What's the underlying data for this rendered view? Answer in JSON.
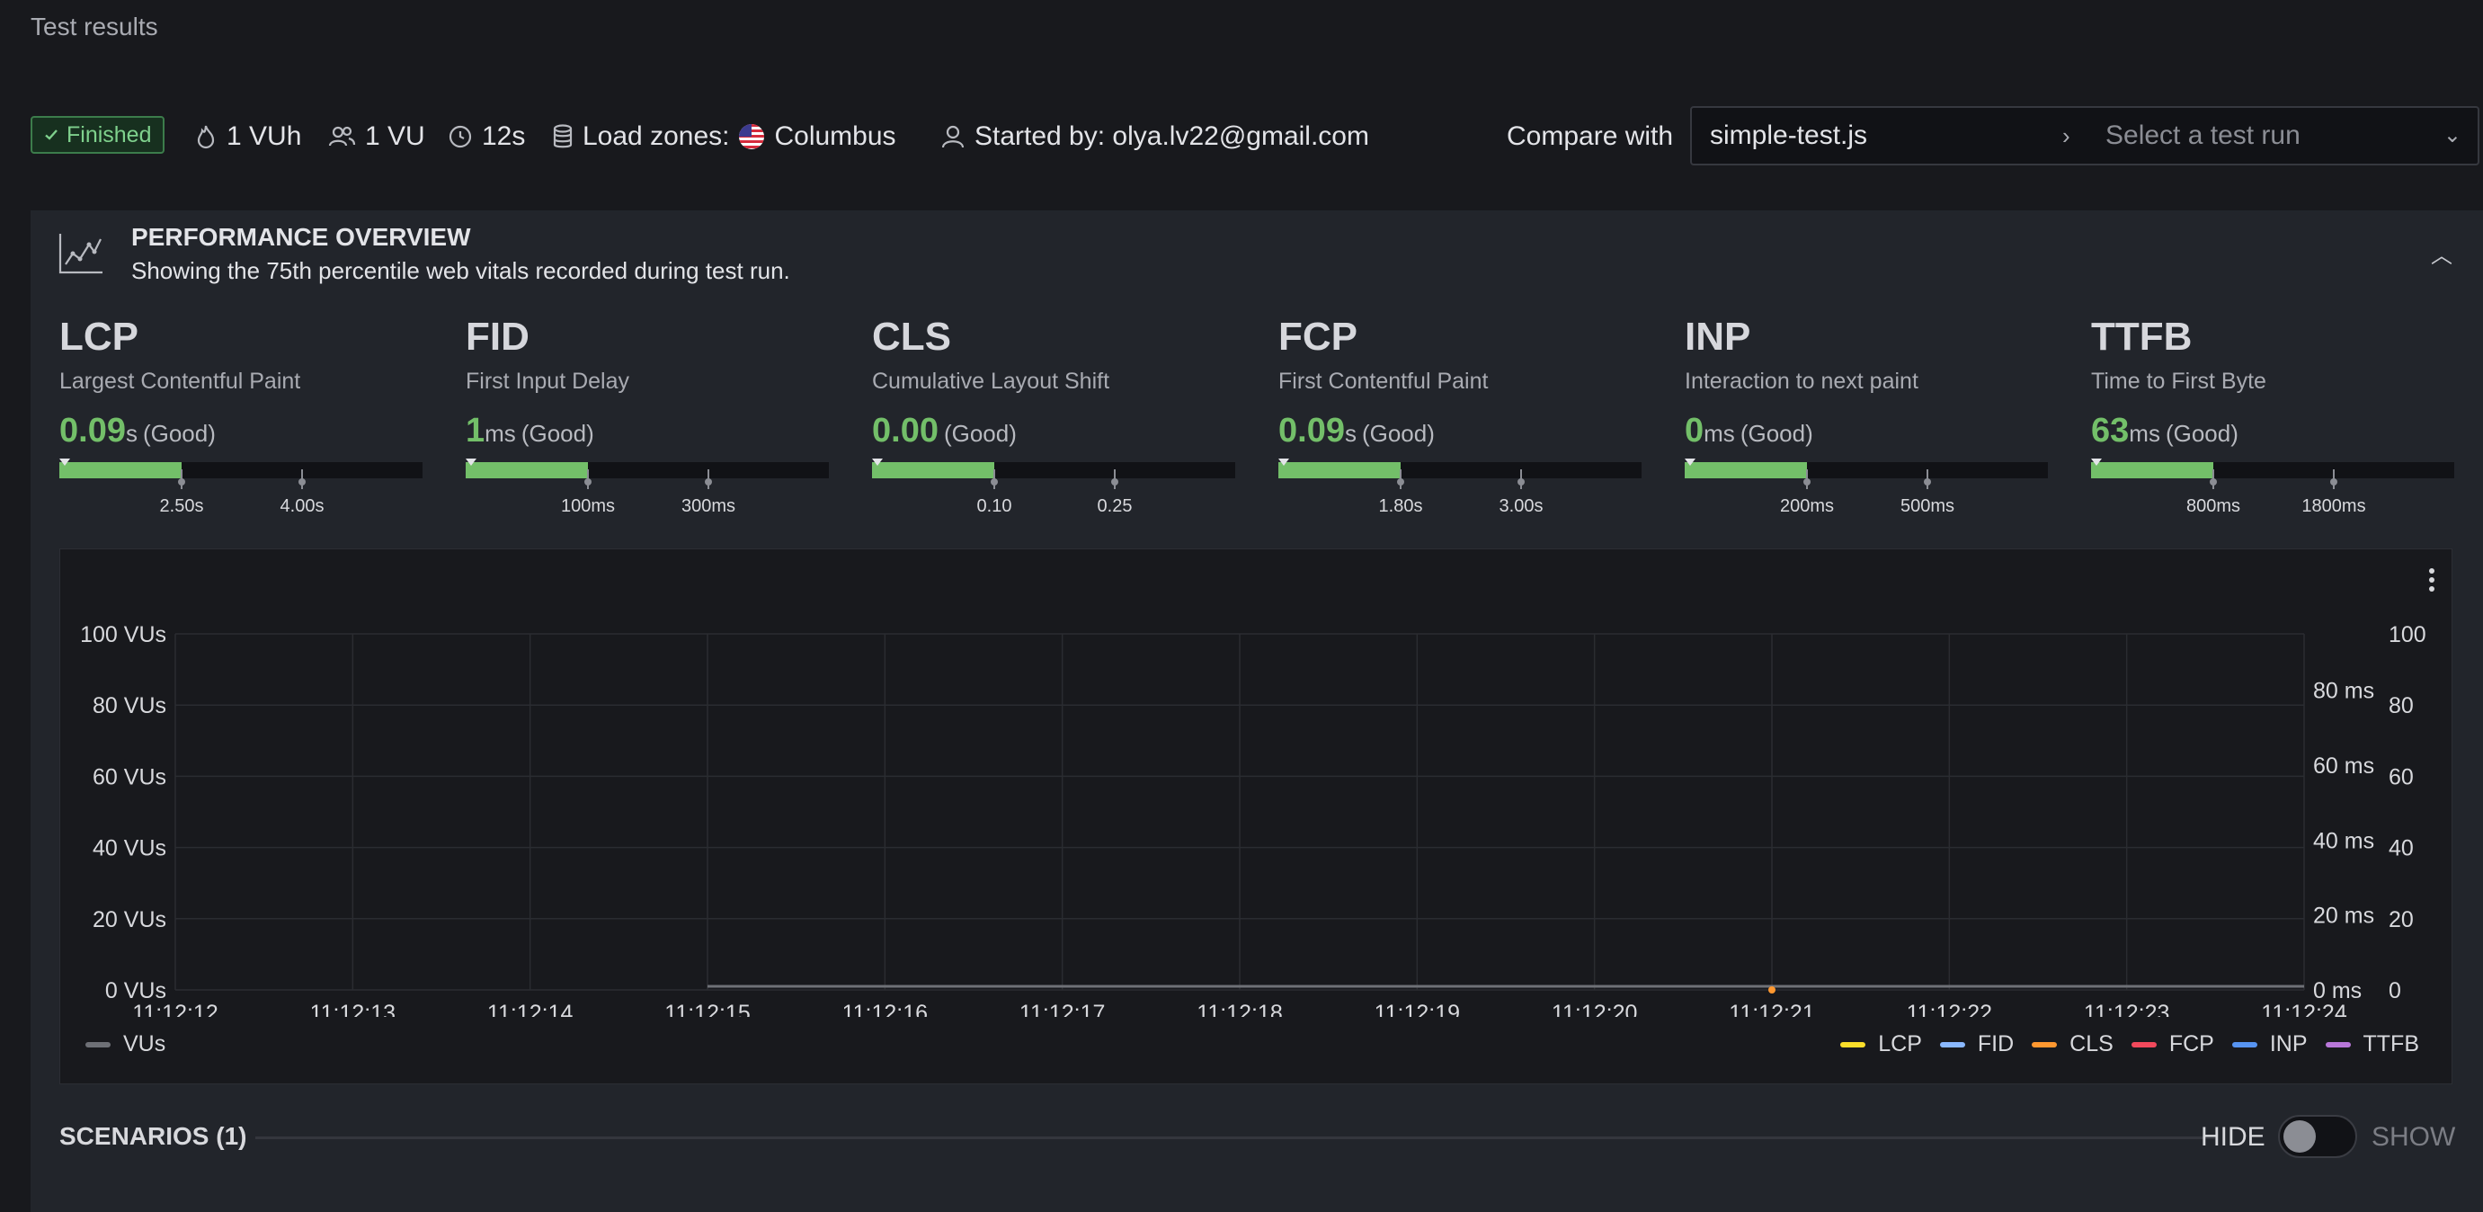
{
  "page_title": "Test results",
  "status": {
    "label": "Finished",
    "color": "#73bf69"
  },
  "meta": {
    "vuh": "1 VUh",
    "vu": "1 VU",
    "duration": "12s",
    "load_zones_label": "Load zones:",
    "load_zone": "Columbus",
    "started_by": "Started by: olya.lv22@gmail.com"
  },
  "compare": {
    "label": "Compare with",
    "test": "simple-test.js",
    "run_placeholder": "Select a test run"
  },
  "performance": {
    "title": "PERFORMANCE OVERVIEW",
    "subtitle": "Showing the 75th percentile web vitals recorded during test run.",
    "vitals": [
      {
        "abbr": "LCP",
        "name": "Largest Contentful Paint",
        "value": "0.09",
        "unit": "s",
        "rating": "(Good)",
        "thresholds": [
          "2.50s",
          "4.00s"
        ]
      },
      {
        "abbr": "FID",
        "name": "First Input Delay",
        "value": "1",
        "unit": "ms",
        "rating": "(Good)",
        "thresholds": [
          "100ms",
          "300ms"
        ]
      },
      {
        "abbr": "CLS",
        "name": "Cumulative Layout Shift",
        "value": "0.00",
        "unit": "",
        "rating": "(Good)",
        "thresholds": [
          "0.10",
          "0.25"
        ]
      },
      {
        "abbr": "FCP",
        "name": "First Contentful Paint",
        "value": "0.09",
        "unit": "s",
        "rating": "(Good)",
        "thresholds": [
          "1.80s",
          "3.00s"
        ]
      },
      {
        "abbr": "INP",
        "name": "Interaction to next paint",
        "value": "0",
        "unit": "ms",
        "rating": "(Good)",
        "thresholds": [
          "200ms",
          "500ms"
        ]
      },
      {
        "abbr": "TTFB",
        "name": "Time to First Byte",
        "value": "63",
        "unit": "ms",
        "rating": "(Good)",
        "thresholds": [
          "800ms",
          "1800ms"
        ]
      }
    ],
    "good_color": "#73bf69"
  },
  "chart_data": {
    "type": "line",
    "x": [
      "11:12:12",
      "11:12:13",
      "11:12:14",
      "11:12:15",
      "11:12:16",
      "11:12:17",
      "11:12:18",
      "11:12:19",
      "11:12:20",
      "11:12:21",
      "11:12:22",
      "11:12:23",
      "11:12:24"
    ],
    "y_left_ticks": [
      "0 VUs",
      "20 VUs",
      "40 VUs",
      "60 VUs",
      "80 VUs",
      "100 VUs"
    ],
    "y_right_ms_ticks": [
      "0 ms",
      "20 ms",
      "40 ms",
      "60 ms",
      "80 ms"
    ],
    "y_right_ticks": [
      "0",
      "20",
      "40",
      "60",
      "80",
      "100"
    ],
    "ylim_left": [
      0,
      100
    ],
    "ylim_ms": [
      0,
      95
    ],
    "ylim_right": [
      0,
      100
    ],
    "grid": true,
    "series": [
      {
        "name": "VUs",
        "color": "#6e7076",
        "axis": "left",
        "x": [
          "11:12:15",
          "11:12:24"
        ],
        "values": [
          1,
          1
        ]
      },
      {
        "name": "CLS",
        "color": "#ff9830",
        "axis": "right",
        "x": [
          "11:12:21"
        ],
        "values": [
          0
        ]
      }
    ],
    "legend_left": [
      {
        "name": "VUs",
        "color": "#6e7076"
      }
    ],
    "legend_right": [
      {
        "name": "LCP",
        "color": "#fade2a"
      },
      {
        "name": "FID",
        "color": "#8ab8ff"
      },
      {
        "name": "CLS",
        "color": "#ff9830"
      },
      {
        "name": "FCP",
        "color": "#f2495c"
      },
      {
        "name": "INP",
        "color": "#5794f2"
      },
      {
        "name": "TTFB",
        "color": "#b877d9"
      }
    ]
  },
  "scenarios": {
    "title": "SCENARIOS (1)",
    "hide_label": "HIDE",
    "show_label": "SHOW"
  }
}
